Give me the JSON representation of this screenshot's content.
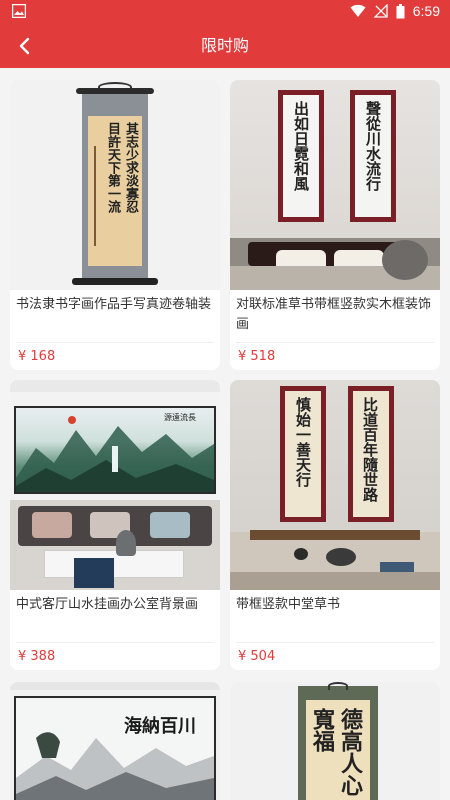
{
  "status_bar": {
    "time": "6:59"
  },
  "header": {
    "title": "限时购"
  },
  "products": [
    {
      "name": "书法隶书字画作品手写真迹卷轴装",
      "price": "¥ 168"
    },
    {
      "name": "对联标准草书带框竖款实木框装饰画",
      "price": "¥ 518"
    },
    {
      "name": "中式客厅山水挂画办公室背景画",
      "price": "¥ 388"
    },
    {
      "name": "带框竖款中堂草书",
      "price": "¥ 504"
    },
    {
      "name": "",
      "price": ""
    },
    {
      "name": "",
      "price": ""
    }
  ],
  "artwork_text": {
    "p1_col1": "其志少求淡寡忍",
    "p1_col2": "目許天下第一流",
    "p2_left": "出如日霓和風",
    "p2_right": "聲從川水流行",
    "p3_title": "源遠流長",
    "p4_left": "慎始一善天行",
    "p4_right": "比道百年隨世路",
    "p5_title": "海納百川",
    "p6_chars": "德高人心寬福"
  },
  "colors": {
    "accent": "#e23b3b",
    "price": "#e23b3b",
    "background": "#f4f4f4"
  }
}
